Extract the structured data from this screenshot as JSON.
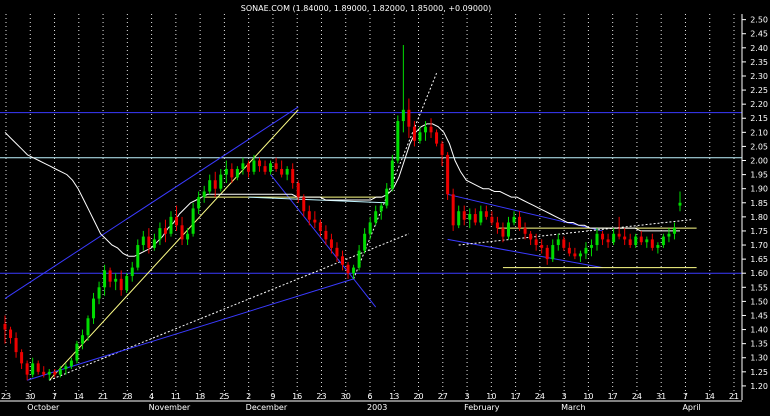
{
  "chart_data": {
    "type": "candlestick",
    "title": "SONAE.COM (1.84000, 1.89000, 1.82000, 1.85000, +0.09000)",
    "ylim": [
      1.15,
      2.52
    ],
    "y_ticks": [
      1.2,
      1.25,
      1.3,
      1.35,
      1.4,
      1.45,
      1.5,
      1.55,
      1.6,
      1.65,
      1.7,
      1.75,
      1.8,
      1.85,
      1.9,
      1.95,
      2.0,
      2.05,
      2.1,
      2.15,
      2.2,
      2.25,
      2.3,
      2.35,
      2.4,
      2.45,
      2.5
    ],
    "x_tick_labels": [
      "23",
      "30",
      "7",
      "14",
      "21",
      "28",
      "4",
      "11",
      "18",
      "25",
      "2",
      "9",
      "16",
      "23",
      "30",
      "6",
      "13",
      "20",
      "27",
      "3",
      "10",
      "17",
      "24",
      "3",
      "10",
      "17",
      "24",
      "31",
      "7",
      "14",
      "21"
    ],
    "month_labels": [
      "October",
      "November",
      "December",
      "2003",
      "February",
      "March",
      "April"
    ],
    "grid": true,
    "horizontal_levels": [
      {
        "value": 2.17,
        "color": "#3a3aff"
      },
      {
        "value": 2.01,
        "color": "#bff4ff"
      },
      {
        "value": 1.6,
        "color": "#3a3aff"
      }
    ],
    "candles": [
      [
        1.42,
        1.45,
        1.35,
        1.4
      ],
      [
        1.4,
        1.41,
        1.35,
        1.37
      ],
      [
        1.37,
        1.39,
        1.3,
        1.32
      ],
      [
        1.32,
        1.33,
        1.26,
        1.28
      ],
      [
        1.28,
        1.29,
        1.22,
        1.24
      ],
      [
        1.24,
        1.3,
        1.23,
        1.28
      ],
      [
        1.28,
        1.29,
        1.24,
        1.25
      ],
      [
        1.25,
        1.27,
        1.23,
        1.24
      ],
      [
        1.24,
        1.26,
        1.22,
        1.25
      ],
      [
        1.25,
        1.26,
        1.23,
        1.24
      ],
      [
        1.24,
        1.27,
        1.23,
        1.26
      ],
      [
        1.26,
        1.28,
        1.24,
        1.27
      ],
      [
        1.27,
        1.3,
        1.26,
        1.29
      ],
      [
        1.29,
        1.36,
        1.28,
        1.35
      ],
      [
        1.35,
        1.4,
        1.33,
        1.38
      ],
      [
        1.38,
        1.45,
        1.36,
        1.44
      ],
      [
        1.44,
        1.53,
        1.42,
        1.51
      ],
      [
        1.51,
        1.57,
        1.49,
        1.55
      ],
      [
        1.55,
        1.63,
        1.52,
        1.61
      ],
      [
        1.61,
        1.62,
        1.55,
        1.57
      ],
      [
        1.57,
        1.6,
        1.54,
        1.58
      ],
      [
        1.58,
        1.61,
        1.52,
        1.54
      ],
      [
        1.54,
        1.6,
        1.53,
        1.59
      ],
      [
        1.59,
        1.64,
        1.57,
        1.62
      ],
      [
        1.62,
        1.72,
        1.61,
        1.7
      ],
      [
        1.7,
        1.75,
        1.68,
        1.73
      ],
      [
        1.73,
        1.76,
        1.67,
        1.69
      ],
      [
        1.69,
        1.74,
        1.68,
        1.72
      ],
      [
        1.72,
        1.78,
        1.7,
        1.76
      ],
      [
        1.76,
        1.79,
        1.71,
        1.74
      ],
      [
        1.74,
        1.82,
        1.73,
        1.8
      ],
      [
        1.8,
        1.84,
        1.75,
        1.77
      ],
      [
        1.77,
        1.8,
        1.7,
        1.72
      ],
      [
        1.72,
        1.76,
        1.7,
        1.74
      ],
      [
        1.74,
        1.85,
        1.73,
        1.83
      ],
      [
        1.83,
        1.89,
        1.81,
        1.87
      ],
      [
        1.87,
        1.91,
        1.85,
        1.89
      ],
      [
        1.89,
        1.95,
        1.88,
        1.93
      ],
      [
        1.93,
        1.96,
        1.87,
        1.9
      ],
      [
        1.9,
        1.97,
        1.89,
        1.95
      ],
      [
        1.95,
        2.0,
        1.92,
        1.97
      ],
      [
        1.97,
        1.99,
        1.92,
        1.94
      ],
      [
        1.94,
        1.98,
        1.93,
        1.97
      ],
      [
        1.97,
        2.01,
        1.95,
        1.99
      ],
      [
        1.99,
        2.0,
        1.94,
        1.96
      ],
      [
        1.96,
        2.02,
        1.95,
        2.0
      ],
      [
        2.0,
        2.01,
        1.96,
        1.98
      ],
      [
        1.98,
        2.0,
        1.95,
        1.96
      ],
      [
        1.96,
        2.0,
        1.95,
        1.99
      ],
      [
        1.99,
        2.01,
        1.96,
        1.97
      ],
      [
        1.97,
        2.0,
        1.94,
        1.95
      ],
      [
        1.95,
        1.98,
        1.93,
        1.97
      ],
      [
        1.97,
        1.99,
        1.9,
        1.92
      ],
      [
        1.92,
        1.93,
        1.85,
        1.87
      ],
      [
        1.87,
        1.88,
        1.8,
        1.82
      ],
      [
        1.82,
        1.84,
        1.77,
        1.79
      ],
      [
        1.79,
        1.82,
        1.76,
        1.78
      ],
      [
        1.78,
        1.79,
        1.73,
        1.75
      ],
      [
        1.75,
        1.77,
        1.7,
        1.72
      ],
      [
        1.72,
        1.74,
        1.67,
        1.69
      ],
      [
        1.69,
        1.71,
        1.64,
        1.66
      ],
      [
        1.66,
        1.68,
        1.61,
        1.63
      ],
      [
        1.63,
        1.64,
        1.58,
        1.6
      ],
      [
        1.6,
        1.63,
        1.58,
        1.62
      ],
      [
        1.62,
        1.7,
        1.61,
        1.68
      ],
      [
        1.68,
        1.76,
        1.67,
        1.74
      ],
      [
        1.74,
        1.8,
        1.72,
        1.78
      ],
      [
        1.78,
        1.84,
        1.77,
        1.82
      ],
      [
        1.82,
        1.85,
        1.79,
        1.84
      ],
      [
        1.84,
        1.92,
        1.83,
        1.9
      ],
      [
        1.9,
        2.02,
        1.89,
        2.0
      ],
      [
        2.0,
        2.16,
        1.99,
        2.14
      ],
      [
        2.14,
        2.41,
        2.1,
        2.18
      ],
      [
        2.18,
        2.22,
        2.08,
        2.12
      ],
      [
        2.12,
        2.14,
        2.05,
        2.07
      ],
      [
        2.07,
        2.12,
        2.06,
        2.1
      ],
      [
        2.1,
        2.14,
        2.07,
        2.12
      ],
      [
        2.12,
        2.15,
        2.08,
        2.1
      ],
      [
        2.1,
        2.11,
        2.05,
        2.06
      ],
      [
        2.06,
        2.07,
        1.98,
        2.02
      ],
      [
        2.02,
        2.03,
        1.86,
        1.88
      ],
      [
        1.88,
        1.9,
        1.75,
        1.77
      ],
      [
        1.77,
        1.84,
        1.76,
        1.82
      ],
      [
        1.82,
        1.84,
        1.77,
        1.79
      ],
      [
        1.79,
        1.83,
        1.76,
        1.81
      ],
      [
        1.81,
        1.83,
        1.77,
        1.78
      ],
      [
        1.78,
        1.84,
        1.77,
        1.82
      ],
      [
        1.82,
        1.84,
        1.79,
        1.8
      ],
      [
        1.8,
        1.82,
        1.77,
        1.78
      ],
      [
        1.78,
        1.8,
        1.74,
        1.76
      ],
      [
        1.76,
        1.78,
        1.71,
        1.73
      ],
      [
        1.73,
        1.8,
        1.72,
        1.78
      ],
      [
        1.78,
        1.82,
        1.77,
        1.8
      ],
      [
        1.8,
        1.82,
        1.75,
        1.76
      ],
      [
        1.76,
        1.78,
        1.72,
        1.74
      ],
      [
        1.74,
        1.75,
        1.7,
        1.72
      ],
      [
        1.72,
        1.74,
        1.68,
        1.7
      ],
      [
        1.7,
        1.72,
        1.67,
        1.69
      ],
      [
        1.69,
        1.7,
        1.63,
        1.65
      ],
      [
        1.65,
        1.72,
        1.64,
        1.7
      ],
      [
        1.7,
        1.74,
        1.68,
        1.72
      ],
      [
        1.72,
        1.73,
        1.68,
        1.69
      ],
      [
        1.69,
        1.71,
        1.66,
        1.67
      ],
      [
        1.67,
        1.69,
        1.65,
        1.66
      ],
      [
        1.66,
        1.68,
        1.64,
        1.67
      ],
      [
        1.67,
        1.71,
        1.65,
        1.69
      ],
      [
        1.69,
        1.72,
        1.66,
        1.7
      ],
      [
        1.7,
        1.76,
        1.68,
        1.74
      ],
      [
        1.74,
        1.75,
        1.7,
        1.72
      ],
      [
        1.72,
        1.74,
        1.69,
        1.71
      ],
      [
        1.71,
        1.76,
        1.7,
        1.74
      ],
      [
        1.74,
        1.8,
        1.72,
        1.73
      ],
      [
        1.73,
        1.76,
        1.7,
        1.72
      ],
      [
        1.72,
        1.74,
        1.69,
        1.7
      ],
      [
        1.7,
        1.74,
        1.69,
        1.73
      ],
      [
        1.73,
        1.75,
        1.7,
        1.71
      ],
      [
        1.71,
        1.73,
        1.69,
        1.72
      ],
      [
        1.72,
        1.74,
        1.68,
        1.69
      ],
      [
        1.69,
        1.71,
        1.67,
        1.7
      ],
      [
        1.7,
        1.74,
        1.69,
        1.73
      ],
      [
        1.73,
        1.76,
        1.71,
        1.74
      ],
      [
        1.74,
        1.78,
        1.72,
        1.76
      ],
      [
        1.84,
        1.89,
        1.82,
        1.85
      ]
    ],
    "moving_average": [
      2.1,
      2.08,
      2.06,
      2.04,
      2.02,
      2.01,
      2.0,
      1.99,
      1.98,
      1.97,
      1.96,
      1.95,
      1.93,
      1.9,
      1.86,
      1.82,
      1.78,
      1.74,
      1.72,
      1.7,
      1.69,
      1.67,
      1.66,
      1.66,
      1.67,
      1.68,
      1.69,
      1.71,
      1.73,
      1.76,
      1.78,
      1.81,
      1.83,
      1.85,
      1.86,
      1.87,
      1.88,
      1.88,
      1.88,
      1.88,
      1.88,
      1.88,
      1.88,
      1.88,
      1.88,
      1.88,
      1.88,
      1.88,
      1.88,
      1.88,
      1.88,
      1.88,
      1.87,
      1.87,
      1.87,
      1.87,
      1.87,
      1.86,
      1.86,
      1.86,
      1.86,
      1.86,
      1.86,
      1.86,
      1.86,
      1.86,
      1.87,
      1.87,
      1.88,
      1.9,
      1.94,
      2.0,
      2.06,
      2.1,
      2.12,
      2.13,
      2.13,
      2.12,
      2.1,
      2.06,
      2.0,
      1.96,
      1.93,
      1.92,
      1.91,
      1.9,
      1.9,
      1.89,
      1.89,
      1.88,
      1.87,
      1.87,
      1.86,
      1.85,
      1.84,
      1.83,
      1.82,
      1.81,
      1.8,
      1.79,
      1.78,
      1.78,
      1.77,
      1.77,
      1.76,
      1.76,
      1.76,
      1.76,
      1.76,
      1.76,
      1.76,
      1.76,
      1.76,
      1.75,
      1.75,
      1.75,
      1.75,
      1.75,
      1.75,
      1.75,
      1.75
    ],
    "colors": {
      "up": "#00dd00",
      "down": "#ee0000",
      "grid": "#ffffff",
      "axis_text": "#ffffff",
      "moving_average": "#ffffff",
      "trend_blue": "#3a3aff",
      "trend_yellow": "#ffff88",
      "trend_cyan": "#bff4ff"
    }
  }
}
